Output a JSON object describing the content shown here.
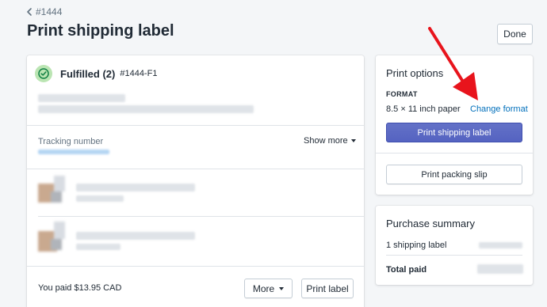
{
  "breadcrumb": {
    "text": "#1444"
  },
  "page": {
    "title": "Print shipping label",
    "done_label": "Done"
  },
  "fulfillment": {
    "title": "Fulfilled (2)",
    "id": "#1444-F1",
    "tracking_label": "Tracking number",
    "show_more_label": "Show more",
    "paid_text": "You paid $13.95 CAD",
    "more_label": "More",
    "print_label": "Print label"
  },
  "print_options": {
    "title": "Print options",
    "format_label": "FORMAT",
    "format_value": "8.5 × 11 inch paper",
    "change_format": "Change format",
    "print_shipping_label": "Print shipping label",
    "print_packing_slip": "Print packing slip"
  },
  "purchase_summary": {
    "title": "Purchase summary",
    "row1_label": "1 shipping label",
    "row2_label": "Total paid"
  },
  "colors": {
    "primary": "#5c6ac4",
    "link": "#006fbb",
    "success_bg": "#bbe5b3",
    "annotation_arrow": "#e8141c"
  }
}
